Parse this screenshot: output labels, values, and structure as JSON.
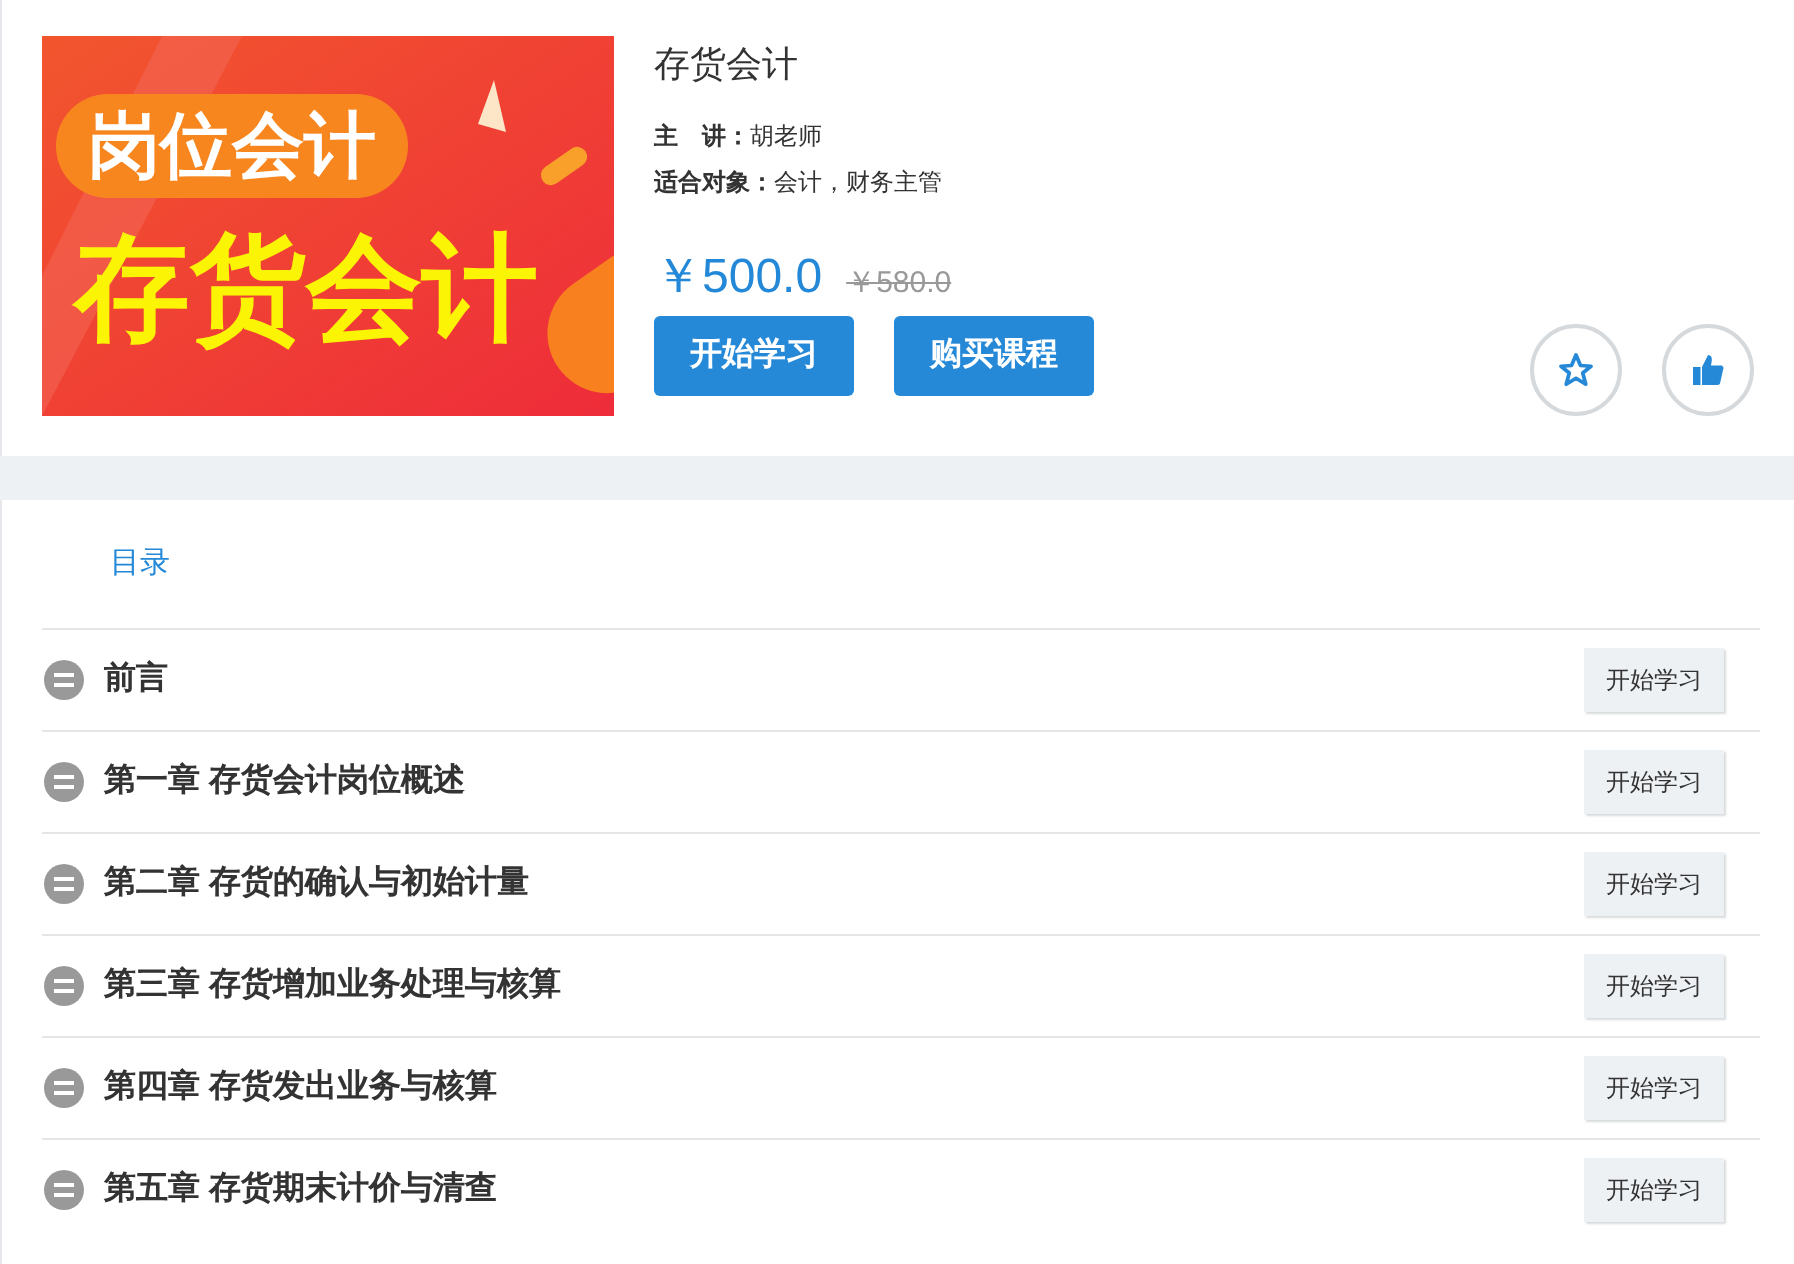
{
  "course": {
    "cover": {
      "badge": "岗位会计",
      "title": "存货会计"
    },
    "title": "存货会计",
    "meta": [
      {
        "label": "主　讲：",
        "value": "胡老师"
      },
      {
        "label": "适合对象：",
        "value": "会计，财务主管"
      }
    ],
    "price": "￥500.0",
    "original_price": "￥580.0",
    "buttons": [
      "开始学习",
      "购买课程"
    ]
  },
  "catalog": {
    "tab": "目录",
    "items": [
      {
        "title": "前言",
        "action": "开始学习"
      },
      {
        "title": "第一章 存货会计岗位概述",
        "action": "开始学习"
      },
      {
        "title": "第二章 存货的确认与初始计量",
        "action": "开始学习"
      },
      {
        "title": "第三章 存货增加业务处理与核算",
        "action": "开始学习"
      },
      {
        "title": "第四章 存货发出业务与核算",
        "action": "开始学习"
      },
      {
        "title": "第五章 存货期末计价与清查",
        "action": "开始学习"
      }
    ]
  }
}
